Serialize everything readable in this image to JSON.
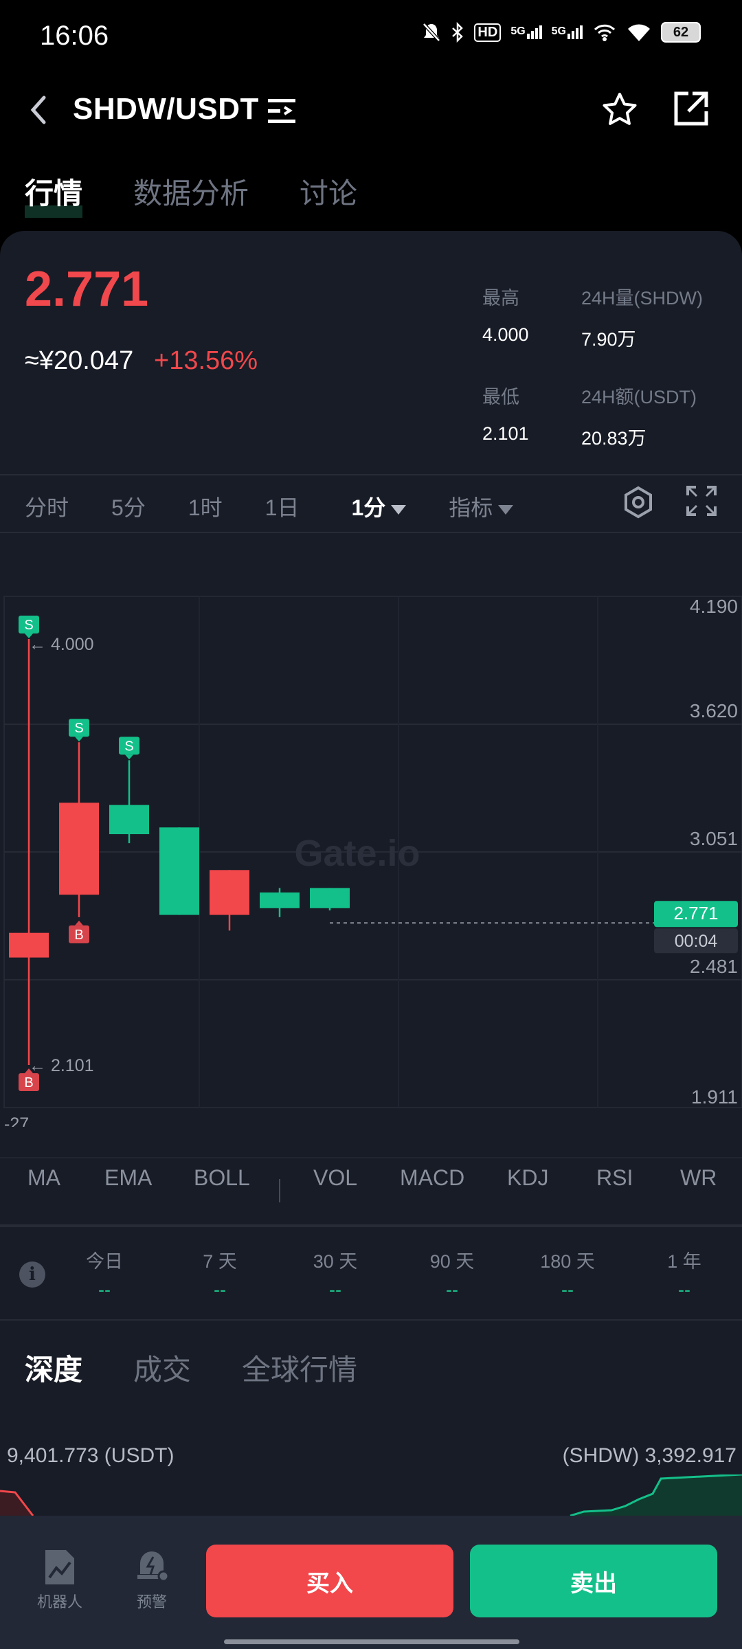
{
  "status_bar": {
    "time": "16:06",
    "network_badges": [
      "HD",
      "5G",
      "5G"
    ],
    "battery": "62"
  },
  "header": {
    "pair": "SHDW/USDT"
  },
  "tabs": [
    {
      "label": "行情",
      "active": true
    },
    {
      "label": "数据分析",
      "active": false
    },
    {
      "label": "讨论",
      "active": false
    }
  ],
  "price": {
    "last": "2.771",
    "cny": "≈¥20.047",
    "change": "+13.56%"
  },
  "stats": {
    "high_label": "最高",
    "high": "4.000",
    "vol_label": "24H量(SHDW)",
    "vol": "7.90万",
    "low_label": "最低",
    "low": "2.101",
    "amt_label": "24H额(USDT)",
    "amt": "20.83万"
  },
  "timeframes": [
    "分时",
    "5分",
    "1时",
    "1日"
  ],
  "timeframe_selected": "1分",
  "indicator_menu": "指标",
  "chart_data": {
    "type": "candlestick",
    "y_ticks": [
      "4.190",
      "3.620",
      "3.051",
      "2.481",
      "1.911"
    ],
    "ylim": [
      1.911,
      4.19
    ],
    "candles": [
      {
        "open": 2.58,
        "close": 2.69,
        "high": 4.0,
        "low": 2.101,
        "color": "red"
      },
      {
        "open": 2.86,
        "close": 3.27,
        "high": 3.54,
        "low": 2.76,
        "color": "red"
      },
      {
        "open": 3.26,
        "close": 3.13,
        "high": 3.46,
        "low": 3.09,
        "color": "green"
      },
      {
        "open": 3.16,
        "close": 2.77,
        "high": 3.16,
        "low": 2.77,
        "color": "green"
      },
      {
        "open": 2.97,
        "close": 2.77,
        "high": 2.97,
        "low": 2.7,
        "color": "red"
      },
      {
        "open": 2.87,
        "close": 2.8,
        "high": 2.89,
        "low": 2.76,
        "color": "green"
      },
      {
        "open": 2.89,
        "close": 2.8,
        "high": 2.89,
        "low": 2.79,
        "color": "green"
      }
    ],
    "markers": [
      {
        "candle": 0,
        "type": "S",
        "at": "high"
      },
      {
        "candle": 0,
        "type": "B",
        "at": "low"
      },
      {
        "candle": 1,
        "type": "S",
        "at": "high"
      },
      {
        "candle": 1,
        "type": "B",
        "at": "low"
      },
      {
        "candle": 2,
        "type": "S",
        "at": "high"
      }
    ],
    "high_annotation": "← 4.000",
    "low_annotation": "← 2.101",
    "last_price_tag": "2.771",
    "countdown_tag": "00:04",
    "bottom_left_label": "-27",
    "watermark": "Gate.io",
    "colors": {
      "up": "#14c08a",
      "down": "#f2474b"
    }
  },
  "indicators": [
    "MA",
    "EMA",
    "BOLL",
    "VOL",
    "MACD",
    "KDJ",
    "RSI",
    "WR"
  ],
  "periods": [
    {
      "label": "今日",
      "value": "--"
    },
    {
      "label": "7 天",
      "value": "--"
    },
    {
      "label": "30 天",
      "value": "--"
    },
    {
      "label": "90 天",
      "value": "--"
    },
    {
      "label": "180 天",
      "value": "--"
    },
    {
      "label": "1 年",
      "value": "--"
    }
  ],
  "bottom_tabs": [
    {
      "label": "深度",
      "active": true
    },
    {
      "label": "成交",
      "active": false
    },
    {
      "label": "全球行情",
      "active": false
    }
  ],
  "depth": {
    "left": "9,401.773 (USDT)",
    "right": "(SHDW) 3,392.917"
  },
  "bottom_bar": {
    "robot": "机器人",
    "alert": "预警",
    "buy": "买入",
    "sell": "卖出"
  }
}
